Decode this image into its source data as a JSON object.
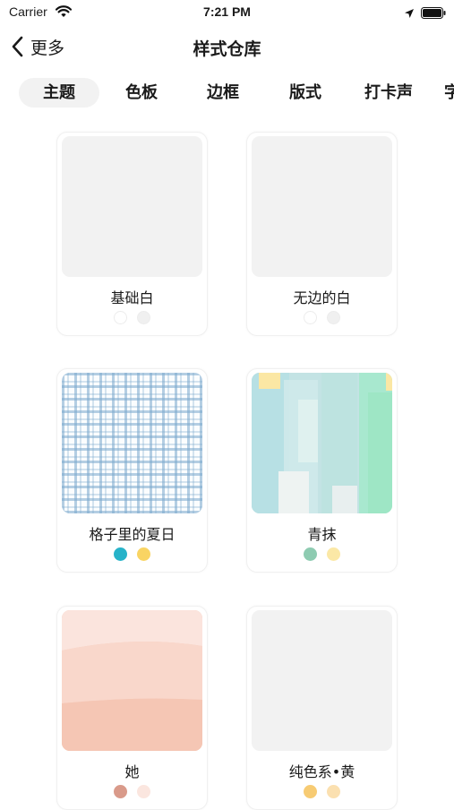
{
  "status_bar": {
    "carrier": "Carrier",
    "time": "7:21 PM"
  },
  "nav": {
    "back_label": "更多",
    "title": "样式仓库"
  },
  "tabs": [
    {
      "label": "主题",
      "active": true
    },
    {
      "label": "色板",
      "active": false
    },
    {
      "label": "边框",
      "active": false
    },
    {
      "label": "版式",
      "active": false
    },
    {
      "label": "打卡声",
      "active": false
    },
    {
      "label": "字",
      "active": false
    }
  ],
  "themes": [
    {
      "name": "基础白",
      "colors": [
        "#ffffff",
        "#f0f0f0"
      ],
      "thumbnail": "plain-light-gray"
    },
    {
      "name": "无边的白",
      "colors": [
        "#ffffff",
        "#f0f0f0"
      ],
      "thumbnail": "plain-light-gray"
    },
    {
      "name": "格子里的夏日",
      "colors": [
        "#27b3c9",
        "#f9d463"
      ],
      "thumbnail": "blue-gingham"
    },
    {
      "name": "青抹",
      "colors": [
        "#8ecbb1",
        "#fbe8a6"
      ],
      "thumbnail": "teal-watercolor"
    },
    {
      "name": "她",
      "colors": [
        "#d99a8a",
        "#fbe6df"
      ],
      "thumbnail": "peach-gradient"
    },
    {
      "name": "纯色系•黄",
      "colors": [
        "#f7cb73",
        "#fbe0b0"
      ],
      "thumbnail": "plain-light-gray"
    }
  ]
}
